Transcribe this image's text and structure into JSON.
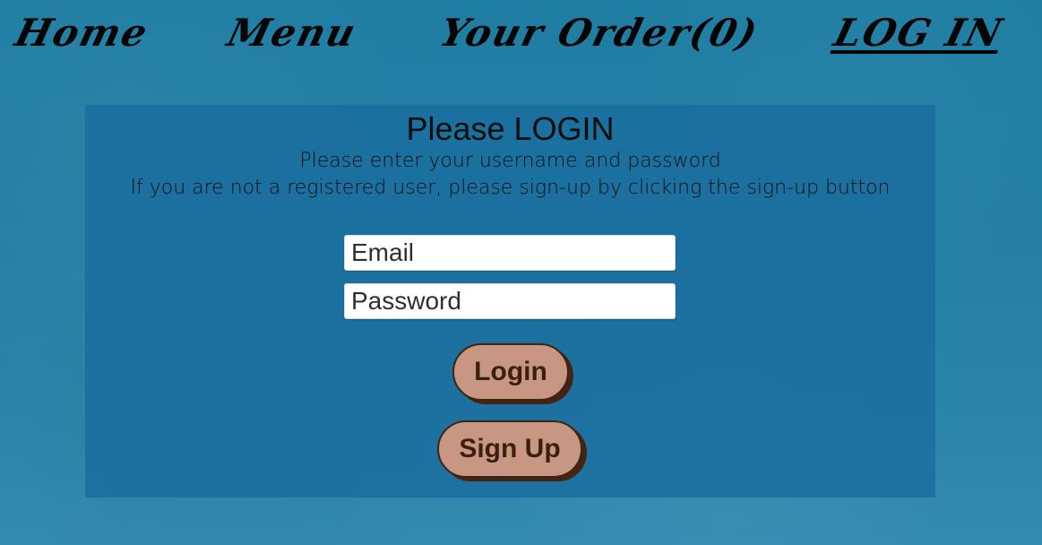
{
  "nav": {
    "home": "Home",
    "menu": "Menu",
    "order": "Your Order(0)",
    "login": "LOG IN"
  },
  "login": {
    "title": "Please LOGIN",
    "subtitle_line1": "Please enter your username and password",
    "subtitle_line2": "If you are not a registered user, please sign-up by clicking the sign-up button",
    "email_placeholder": "Email",
    "password_placeholder": "Password",
    "login_button": "Login",
    "signup_button": "Sign Up"
  },
  "colors": {
    "background": "#257fa5",
    "panel": "#186c9e",
    "button": "#c89783",
    "button_text": "#3b1f0f"
  }
}
